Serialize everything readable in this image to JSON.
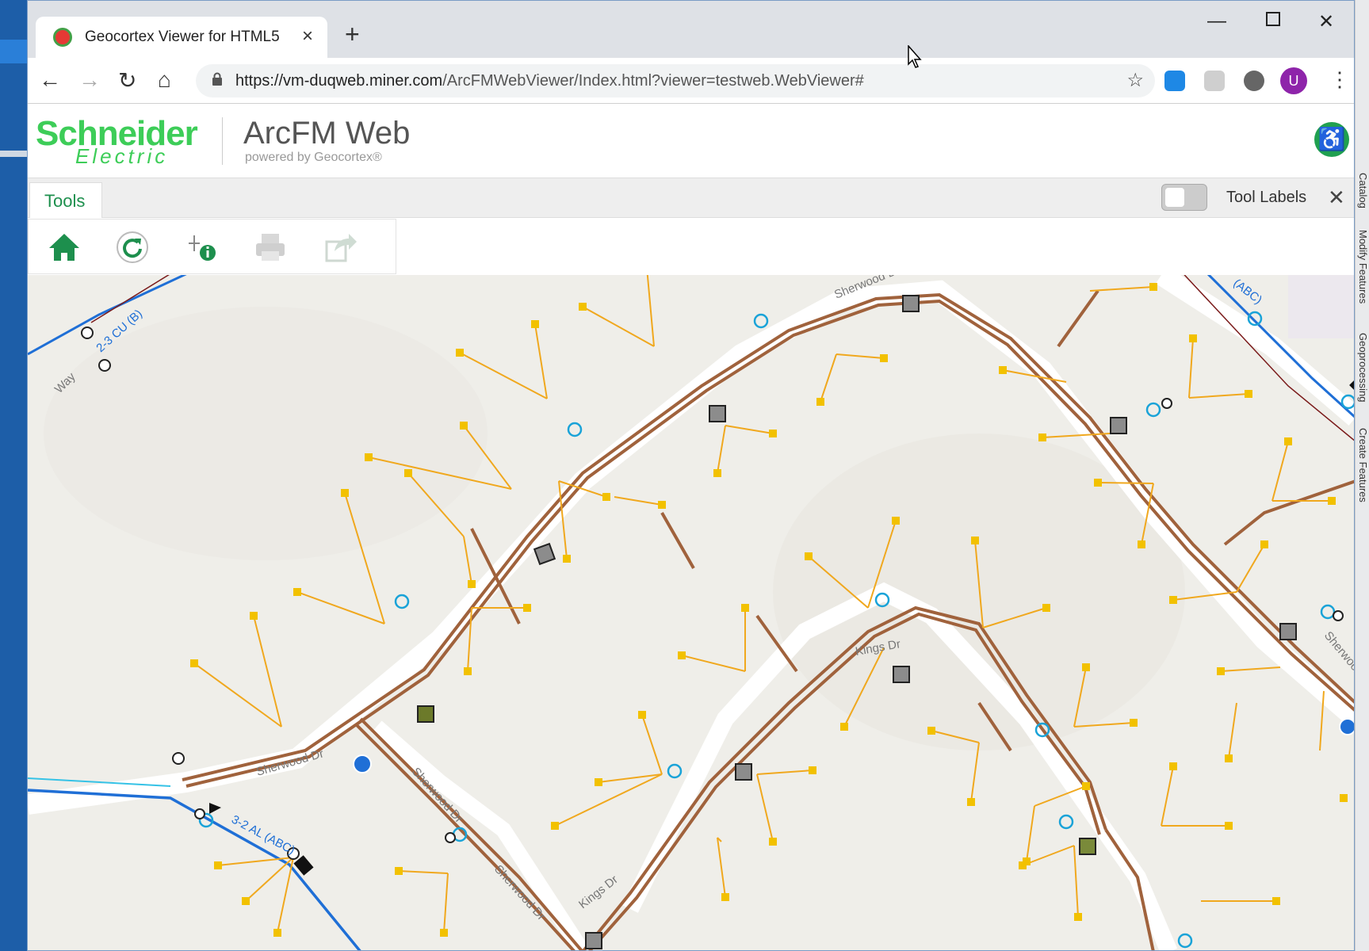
{
  "browser": {
    "tab_title": "Geocortex Viewer for HTML5",
    "tab_close": "×",
    "new_tab": "+",
    "url_host": "https://vm-duqweb.miner.com",
    "url_path": "/ArcFMWebViewer/Index.html?viewer=testweb.WebViewer#",
    "avatar_letter": "U"
  },
  "app": {
    "brand_line1": "Schneider",
    "brand_line2": "Electric",
    "name": "ArcFM Web",
    "tagline": "powered by Geocortex®"
  },
  "tools": {
    "tab_label": "Tools",
    "tool_labels_text": "Tool Labels",
    "close": "✕",
    "buttons": [
      "home-icon",
      "refresh-icon",
      "identify-icon",
      "print-icon",
      "share-icon"
    ]
  },
  "side_panels": [
    "Catalog",
    "Modify Features",
    "Geoprocessing",
    "Create Features"
  ],
  "map": {
    "street_labels": [
      "Sherwood Dr",
      "Sherwood Dr",
      "Sherwood Dr",
      "Sherwood Dr",
      "Kings Dr",
      "Kings Dr",
      "Sherwood Dr",
      "Way"
    ],
    "line_labels": [
      "2-3 CU (B)",
      "3-2 AL (ABC)",
      "(ABC)"
    ]
  },
  "colors": {
    "accent_green": "#3dcd58",
    "conductor_brown": "#a0623c",
    "service_orange": "#f0a81e",
    "primary_blue": "#1f6fd6"
  }
}
